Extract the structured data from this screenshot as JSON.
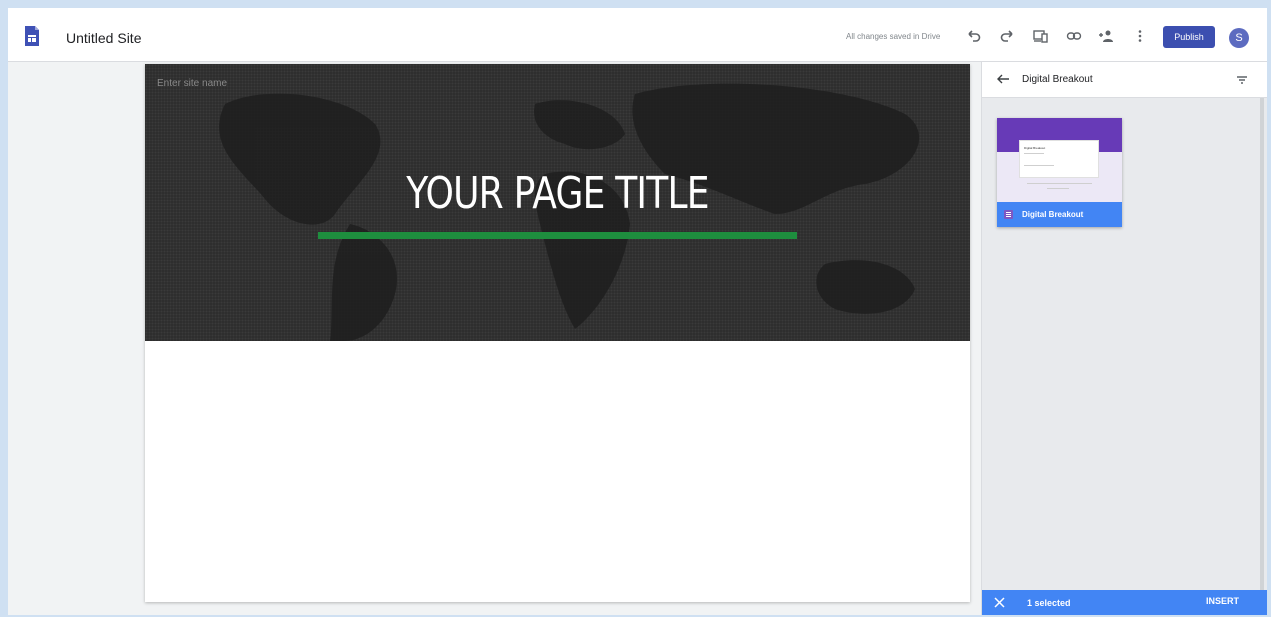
{
  "header": {
    "site_title": "Untitled Site",
    "save_status": "All changes saved in Drive",
    "icons": [
      "undo-icon",
      "redo-icon",
      "preview-icon",
      "link-icon",
      "share-icon",
      "more-icon"
    ],
    "publish_label": "Publish",
    "avatar_initial": "S"
  },
  "hero": {
    "site_name_placeholder": "Enter site name",
    "page_title": "YOUR PAGE TITLE",
    "underline_color": "#1e8e3e"
  },
  "panel": {
    "title": "Digital Breakout",
    "file": {
      "name": "Digital Breakout",
      "thumbnail_title": "Digital Breakout"
    },
    "selection": {
      "count_label": "1 selected",
      "insert_label": "INSERT"
    }
  },
  "colors": {
    "accent": "#4285f4",
    "publish": "#3c4fb0",
    "forms_purple": "#673ab7"
  }
}
